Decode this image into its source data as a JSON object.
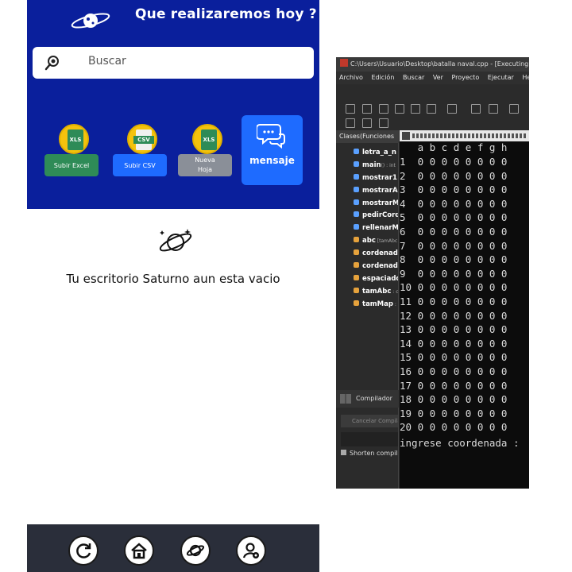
{
  "app": {
    "header_title": "Que realizaremos hoy ?",
    "search_placeholder": "Buscar",
    "actions": [
      {
        "label": "Subir Excel",
        "icon_text": "XLS",
        "icon": "excel-file-icon",
        "color": "#2e8b57"
      },
      {
        "label": "Subir CSV",
        "icon_text": "CSV",
        "icon": "csv-file-icon",
        "color": "#1e6bff"
      },
      {
        "label": "Nueva Hoja",
        "icon_text": "XLS",
        "icon": "new-sheet-icon",
        "color": "#8a8f98"
      }
    ],
    "message_button": "mensaje",
    "empty_message": "Tu escritorio Saturno aun esta vacio",
    "bottom_nav": [
      "refresh-icon",
      "home-icon",
      "planet-icon",
      "user-settings-icon"
    ],
    "colors": {
      "primary": "#0a1f9c",
      "accent": "#1e6bff",
      "yellow": "#f4c20d"
    }
  },
  "ide": {
    "title": "C:\\Users\\Usuario\\Desktop\\batalla naval.cpp - [Executing]",
    "menu": [
      "Archivo",
      "Edición",
      "Buscar",
      "Ver",
      "Proyecto",
      "Ejecutar",
      "Herram"
    ],
    "class_panel_title": "Clases(Funciones",
    "class_items": [
      {
        "name": "letra_a_n",
        "suffix": "",
        "color": "#5aa0ff"
      },
      {
        "name": "main",
        "suffix": "() : int",
        "color": "#5aa0ff"
      },
      {
        "name": "mostrar1",
        "suffix": "",
        "color": "#5aa0ff"
      },
      {
        "name": "mostrarA",
        "suffix": "",
        "color": "#5aa0ff"
      },
      {
        "name": "mostrarM",
        "suffix": "",
        "color": "#5aa0ff"
      },
      {
        "name": "pedirCord",
        "suffix": "",
        "color": "#5aa0ff"
      },
      {
        "name": "rellenarM",
        "suffix": "",
        "color": "#5aa0ff"
      },
      {
        "name": "abc",
        "suffix": " [tamAbc",
        "color": "#e6a23c"
      },
      {
        "name": "cordenada",
        "suffix": "",
        "color": "#e6a23c"
      },
      {
        "name": "cordenada",
        "suffix": "",
        "color": "#e6a23c"
      },
      {
        "name": "espaciado",
        "suffix": "",
        "color": "#e6a23c"
      },
      {
        "name": "tamAbc",
        "suffix": " : c",
        "color": "#e6a23c"
      },
      {
        "name": "tamMap",
        "suffix": " :",
        "color": "#e6a23c"
      }
    ],
    "compiler_tab": "Compilador",
    "cancel_label": "Cancelar Compila",
    "shorten_label": "Shorten compil",
    "console": {
      "header": "   a b c d e f g h",
      "rows": [
        "1  0 0 0 0 0 0 0 0",
        "2  0 0 0 0 0 0 0 0",
        "3  0 0 0 0 0 0 0 0",
        "4  0 0 0 0 0 0 0 0",
        "5  0 0 0 0 0 0 0 0",
        "6  0 0 0 0 0 0 0 0",
        "7  0 0 0 0 0 0 0 0",
        "8  0 0 0 0 0 0 0 0",
        "9  0 0 0 0 0 0 0 0",
        "10 0 0 0 0 0 0 0 0",
        "11 0 0 0 0 0 0 0 0",
        "12 0 0 0 0 0 0 0 0",
        "13 0 0 0 0 0 0 0 0",
        "14 0 0 0 0 0 0 0 0",
        "15 0 0 0 0 0 0 0 0",
        "16 0 0 0 0 0 0 0 0",
        "17 0 0 0 0 0 0 0 0",
        "18 0 0 0 0 0 0 0 0",
        "19 0 0 0 0 0 0 0 0",
        "20 0 0 0 0 0 0 0 0"
      ],
      "prompt": "ingrese coordenada :"
    }
  }
}
